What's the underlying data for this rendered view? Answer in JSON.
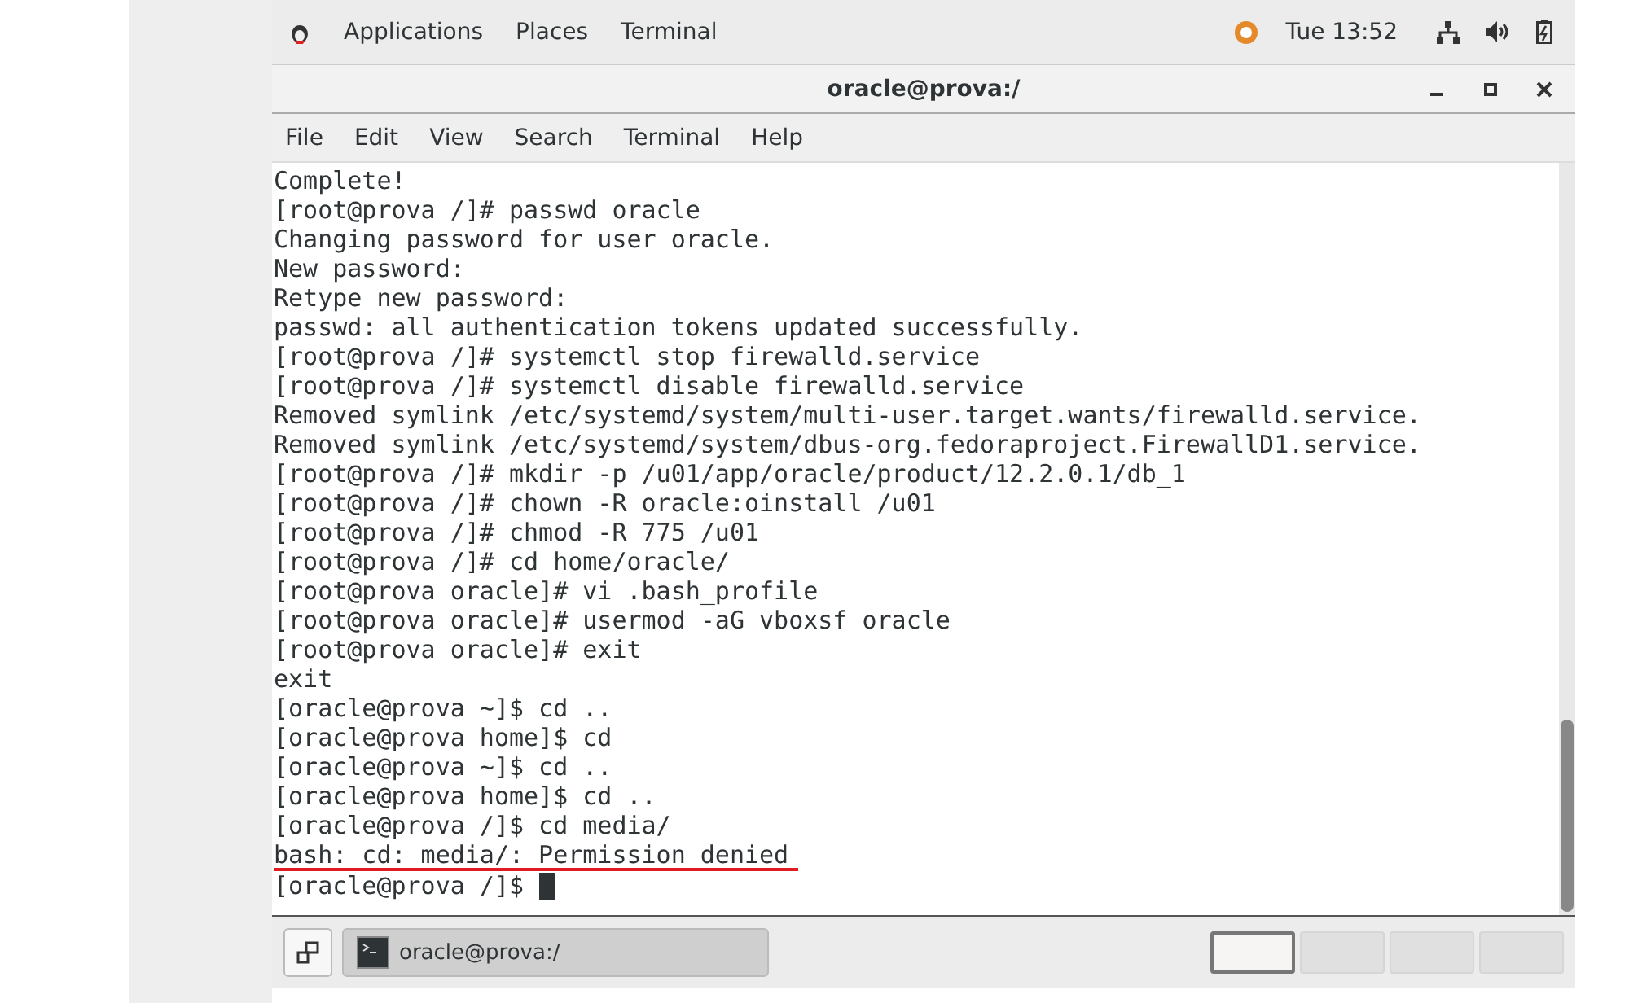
{
  "top_bar": {
    "menus": [
      "Applications",
      "Places",
      "Terminal"
    ],
    "clock": "Tue 13:52"
  },
  "window": {
    "title": "oracle@prova:/"
  },
  "menu_bar": [
    "File",
    "Edit",
    "View",
    "Search",
    "Terminal",
    "Help"
  ],
  "terminal": {
    "lines": [
      {
        "text": "Complete!",
        "highlighted": false
      },
      {
        "text": "[root@prova /]# passwd oracle",
        "highlighted": false
      },
      {
        "text": "Changing password for user oracle.",
        "highlighted": false
      },
      {
        "text": "New password:",
        "highlighted": false
      },
      {
        "text": "Retype new password:",
        "highlighted": false
      },
      {
        "text": "passwd: all authentication tokens updated successfully.",
        "highlighted": false
      },
      {
        "text": "[root@prova /]# systemctl stop firewalld.service",
        "highlighted": false
      },
      {
        "text": "[root@prova /]# systemctl disable firewalld.service",
        "highlighted": false
      },
      {
        "text": "Removed symlink /etc/systemd/system/multi-user.target.wants/firewalld.service.",
        "highlighted": false
      },
      {
        "text": "Removed symlink /etc/systemd/system/dbus-org.fedoraproject.FirewallD1.service.",
        "highlighted": false
      },
      {
        "text": "[root@prova /]# mkdir -p /u01/app/oracle/product/12.2.0.1/db_1",
        "highlighted": false
      },
      {
        "text": "[root@prova /]# chown -R oracle:oinstall /u01",
        "highlighted": false
      },
      {
        "text": "[root@prova /]# chmod -R 775 /u01",
        "highlighted": false
      },
      {
        "text": "[root@prova /]# cd home/oracle/",
        "highlighted": false
      },
      {
        "text": "[root@prova oracle]# vi .bash_profile",
        "highlighted": false
      },
      {
        "text": "[root@prova oracle]# usermod -aG vboxsf oracle",
        "highlighted": false
      },
      {
        "text": "[root@prova oracle]# exit",
        "highlighted": false
      },
      {
        "text": "exit",
        "highlighted": false
      },
      {
        "text": "[oracle@prova ~]$ cd ..",
        "highlighted": false
      },
      {
        "text": "[oracle@prova home]$ cd",
        "highlighted": false
      },
      {
        "text": "[oracle@prova ~]$ cd ..",
        "highlighted": false
      },
      {
        "text": "[oracle@prova home]$ cd ..",
        "highlighted": false
      },
      {
        "text": "[oracle@prova /]$ cd media/",
        "highlighted": false
      },
      {
        "text": "bash: cd: media/: Permission denied",
        "highlighted": true
      }
    ],
    "prompt": "[oracle@prova /]$"
  },
  "taskbar": {
    "windows": [
      {
        "label": "oracle@prova:/",
        "selected": true
      }
    ],
    "workspaces": [
      {
        "selected": true
      },
      {
        "selected": false
      },
      {
        "selected": false
      },
      {
        "selected": false
      }
    ]
  }
}
